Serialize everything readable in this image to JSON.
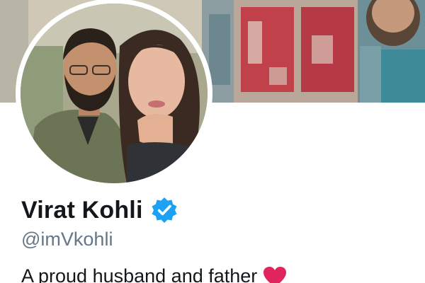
{
  "profile": {
    "display_name": "Virat Kohli",
    "handle": "@imVkohli",
    "bio": "A proud husband and father",
    "verified": true,
    "icons": {
      "verified": "verified-badge-icon",
      "bio_emoji": "red-heart-icon"
    },
    "colors": {
      "name": "#14171a",
      "handle": "#657786",
      "verified_badge": "#1da1f2",
      "heart": "#e0245e"
    }
  }
}
